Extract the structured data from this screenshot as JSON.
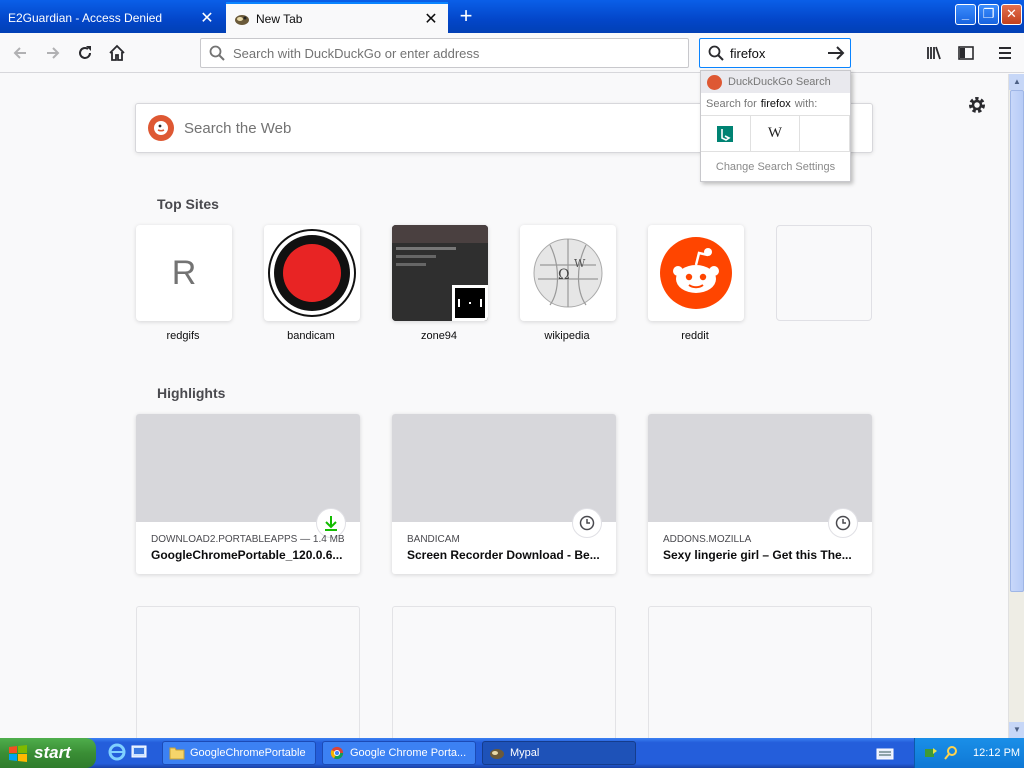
{
  "tabs": [
    {
      "title": "E2Guardian - Access Denied",
      "active": false
    },
    {
      "title": "New Tab",
      "active": true
    }
  ],
  "toolbar": {
    "urlbar_placeholder": "Search with DuckDuckGo or enter address",
    "search_value": "firefox"
  },
  "search_popup": {
    "engine_name": "DuckDuckGo Search",
    "search_for_prefix": "Search for",
    "search_term": "firefox",
    "search_for_suffix": "with:",
    "engines": [
      "bing",
      "wikipedia",
      ""
    ],
    "settings_label": "Change Search Settings"
  },
  "newtab": {
    "search_placeholder": "Search the Web",
    "top_sites_title": "Top Sites",
    "top_sites": [
      {
        "label": "redgifs",
        "letter": "R"
      },
      {
        "label": "bandicam",
        "letter": ""
      },
      {
        "label": "zone94",
        "letter": ""
      },
      {
        "label": "wikipedia",
        "letter": ""
      },
      {
        "label": "reddit",
        "letter": ""
      },
      {
        "label": "",
        "letter": ""
      }
    ],
    "highlights_title": "Highlights",
    "highlights": [
      {
        "source": "DOWNLOAD2.PORTABLEAPPS — 1.4 MB",
        "title": "GoogleChromePortable_120.0.6...",
        "icon": "download-icon"
      },
      {
        "source": "BANDICAM",
        "title": "Screen Recorder Download - Be...",
        "icon": "clock-icon"
      },
      {
        "source": "ADDONS.MOZILLA",
        "title": "Sexy lingerie girl – Get this The...",
        "icon": "clock-icon"
      }
    ]
  },
  "taskbar": {
    "start_label": "start",
    "tasks": [
      {
        "label": "GoogleChromePortable"
      },
      {
        "label": "Google Chrome Porta..."
      },
      {
        "label": "Mypal"
      }
    ],
    "clock": "12:12 PM"
  },
  "colors": {
    "accent": "#0a84ff",
    "xp_blue": "#245edb",
    "ddg_orange": "#de5833",
    "reddit_orange": "#ff4500",
    "download_green": "#12bc00"
  }
}
